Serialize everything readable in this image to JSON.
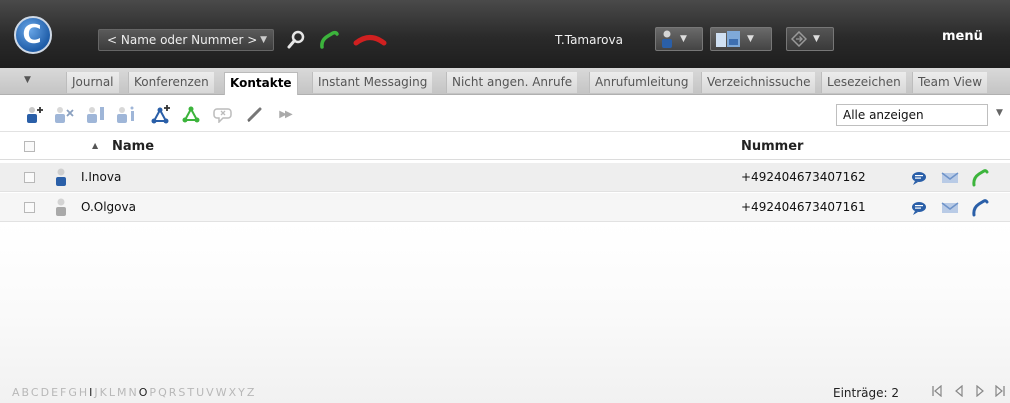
{
  "header": {
    "search_placeholder": "< Name oder Nummer >",
    "username": "T.Tamarova",
    "menu_label": "menü",
    "colors": {
      "accent": "#1f5da8",
      "call_green": "#3cb43c",
      "hangup_red": "#d02020"
    }
  },
  "tabs": [
    {
      "label": "Journal"
    },
    {
      "label": "Konferenzen"
    },
    {
      "label": "Kontakte",
      "active": true
    },
    {
      "label": "Instant Messaging"
    },
    {
      "label": "Nicht angen. Anrufe"
    },
    {
      "label": "Anrufumleitung"
    },
    {
      "label": "Verzeichnissuche"
    },
    {
      "label": "Lesezeichen"
    },
    {
      "label": "Team View"
    }
  ],
  "toolbar": {
    "icons": [
      "add-contact-icon",
      "delete-contact-icon",
      "edit-contact-icon",
      "contact-info-icon",
      "add-group-icon",
      "group-icon",
      "chat-group-icon",
      "pencil-icon",
      "more-icon"
    ],
    "filter_value": "Alle anzeigen"
  },
  "table": {
    "columns": {
      "name": "Name",
      "number": "Nummer"
    },
    "rows": [
      {
        "name": "I.Inova",
        "number": "+492404673407162",
        "presence": "blue",
        "call_color": "#3cb43c"
      },
      {
        "name": "O.Olgova",
        "number": "+492404673407161",
        "presence": "gray",
        "call_color": "#2a5fa8"
      }
    ]
  },
  "footer": {
    "alphabet": [
      "A",
      "B",
      "C",
      "D",
      "E",
      "F",
      "G",
      "H",
      "I",
      "J",
      "K",
      "L",
      "M",
      "N",
      "O",
      "P",
      "Q",
      "R",
      "S",
      "T",
      "U",
      "V",
      "W",
      "X",
      "Y",
      "Z"
    ],
    "active_letters": [
      "I",
      "O"
    ],
    "entries_label": "Einträge: 2"
  }
}
